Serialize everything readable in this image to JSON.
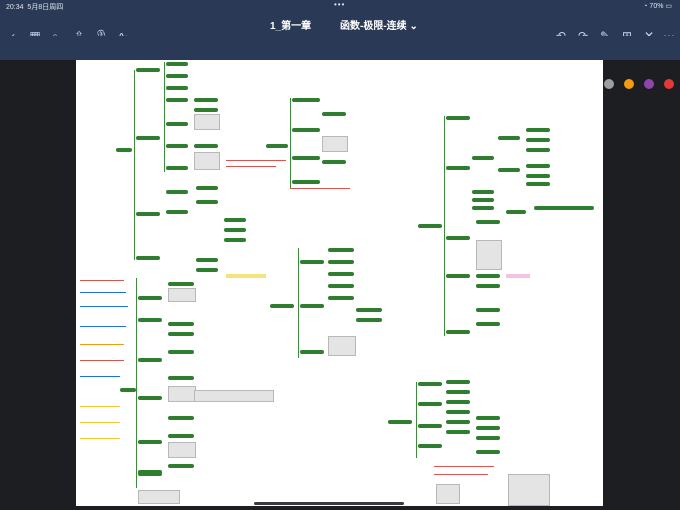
{
  "status_bar": {
    "time": "20:34",
    "date": "5月8日周四",
    "dots": "•••",
    "battery": "70%"
  },
  "nav": {
    "title_left": "1_第一章",
    "title_right": "函数-极限-连续",
    "title_caret": "⌄"
  },
  "colors": {
    "toolbar_bg": "#2a3a56",
    "node_green": "#2f7d2f",
    "canvas_bg": "#ffffff",
    "selected_color": "#e53935"
  },
  "icons": {
    "nav_left": [
      "back-icon",
      "grid-icon",
      "search-icon",
      "share-icon",
      "mic-icon",
      "waveform-icon"
    ],
    "nav_right": [
      "undo-icon",
      "redo-icon",
      "edit-icon",
      "add-page-icon",
      "close-icon",
      "more-icon"
    ],
    "tools": [
      "image-icon",
      "pen-icon",
      "eraser-icon",
      "highlighter-icon",
      "lasso-icon",
      "shape-icon",
      "star-icon",
      "photo-icon",
      "sticker-icon",
      "text-icon",
      "ruler-icon"
    ]
  },
  "palette": [
    "#000000",
    "#1e6fe0",
    "#1e6fe0",
    "#1e6fe0",
    "#4caf50",
    "#e53935",
    "#f5e663",
    "#9e9e9e",
    "#f39c12",
    "#8e44ad",
    "#e53935"
  ]
}
